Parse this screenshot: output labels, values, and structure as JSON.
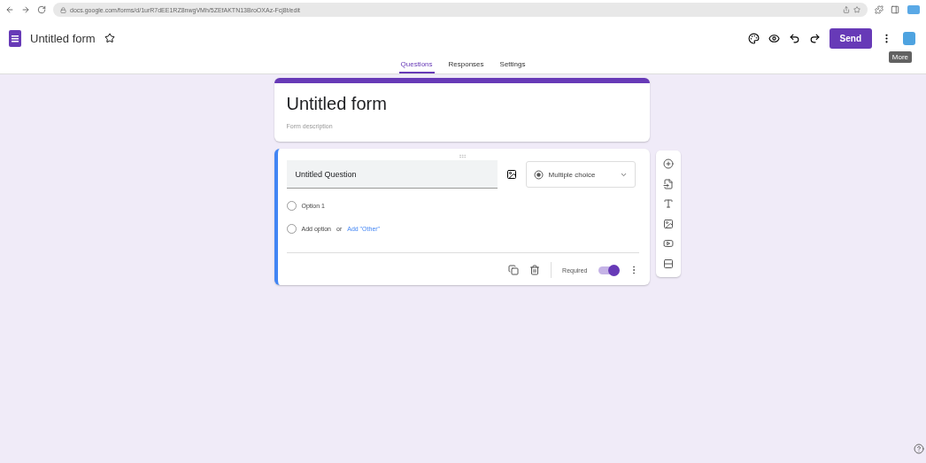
{
  "browser": {
    "url": "docs.google.com/forms/d/1urR7dEE1RZ8nwgVMh/5ZEfAKTN13BroOXAz-Fcj8t/edit"
  },
  "header": {
    "title": "Untitled form",
    "send": "Send",
    "tooltip": "More"
  },
  "tabs": [
    {
      "label": "Questions",
      "selected": true
    },
    {
      "label": "Responses",
      "selected": false
    },
    {
      "label": "Settings",
      "selected": false
    }
  ],
  "form": {
    "title": "Untitled form",
    "description_placeholder": "Form description"
  },
  "question": {
    "title": "Untitled Question",
    "type": "Multiple choice",
    "options": [
      {
        "label": "Option 1",
        "kind": "option"
      },
      {
        "label": "Add option",
        "kind": "add",
        "connector": "or",
        "link": "Add \"Other\""
      }
    ],
    "required_label": "Required",
    "required": true
  }
}
